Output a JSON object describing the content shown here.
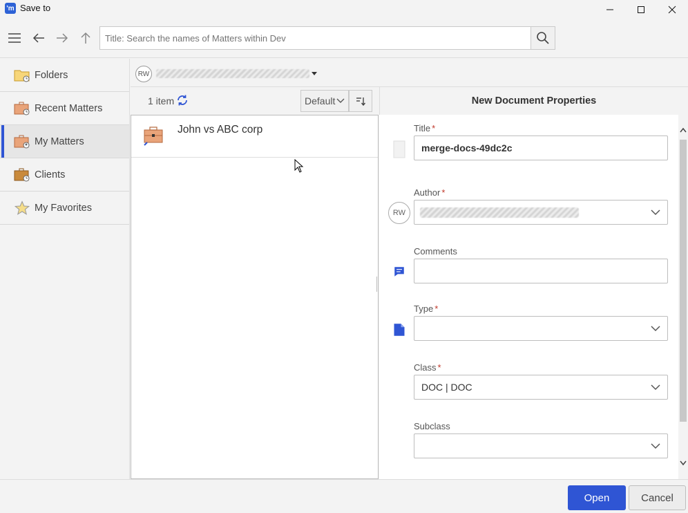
{
  "window": {
    "app_icon_text": "'m",
    "title": "Save to"
  },
  "toolbar": {
    "search_placeholder": "Title: Search the names of Matters within Dev"
  },
  "sidebar": {
    "items": [
      {
        "label": "Folders",
        "icon": "folder-icon"
      },
      {
        "label": "Recent Matters",
        "icon": "recent-matters-icon"
      },
      {
        "label": "My Matters",
        "icon": "my-matters-icon",
        "active": true
      },
      {
        "label": "Clients",
        "icon": "clients-icon"
      },
      {
        "label": "My Favorites",
        "icon": "star-icon"
      }
    ]
  },
  "user": {
    "initials": "RW"
  },
  "list": {
    "count_label": "1 item",
    "sort_value": "Default",
    "items": [
      {
        "name": "John vs ABC corp"
      }
    ]
  },
  "properties": {
    "header": "New Document Properties",
    "title_label": "Title",
    "title_value": "merge-docs-49dc2c",
    "author_label": "Author",
    "author_initials": "RW",
    "comments_label": "Comments",
    "comments_value": "",
    "type_label": "Type",
    "type_value": "",
    "class_label": "Class",
    "class_value": "DOC | DOC",
    "subclass_label": "Subclass",
    "subclass_value": "",
    "required_mark": "*"
  },
  "footer": {
    "open_label": "Open",
    "cancel_label": "Cancel"
  },
  "colors": {
    "accent": "#2f55d4",
    "required": "#c0392b"
  }
}
